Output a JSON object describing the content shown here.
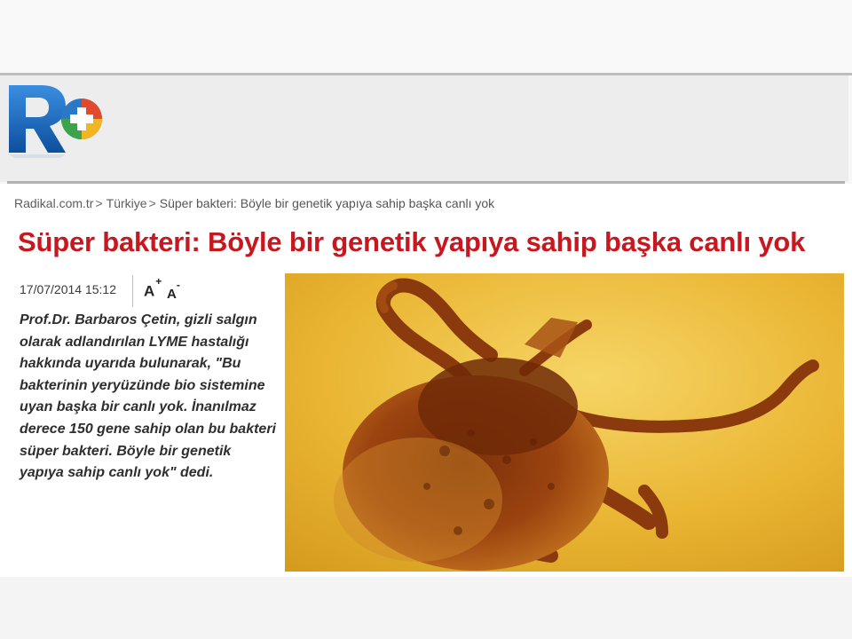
{
  "site": {
    "logo_icon": "radikal-plus-logo-icon"
  },
  "breadcrumb": {
    "items": [
      {
        "label": "Radikal.com.tr"
      },
      {
        "label": "Türkiye"
      },
      {
        "label": "Süper bakteri: Böyle bir genetik yapıya sahip başka canlı yok"
      }
    ],
    "separator": ">"
  },
  "article": {
    "title": "Süper bakteri: Böyle bir genetik yapıya sahip başka canlı yok",
    "date": "17/07/2014 15:12",
    "font_increase_label": "A",
    "font_increase_sup": "+",
    "font_decrease_label": "A",
    "font_decrease_sup": "-",
    "lead": "Prof.Dr. Barbaros Çetin, gizli salgın olarak adlandırılan LYME hastalığı hakkında uyarıda bulunarak, \"Bu bakterinin yeryüzünde bio sistemine uyan başka bir canlı yok. İnanılmaz derece 150 gene sahip olan bu bakteri süper bakteri. Böyle bir genetik yapıya sahip canlı yok\" dedi.",
    "image_subject": "tick-photo"
  },
  "colors": {
    "title_red": "#c8171f",
    "photo_amber": "#e8b42a",
    "logo_blue": "#1b5fae"
  }
}
